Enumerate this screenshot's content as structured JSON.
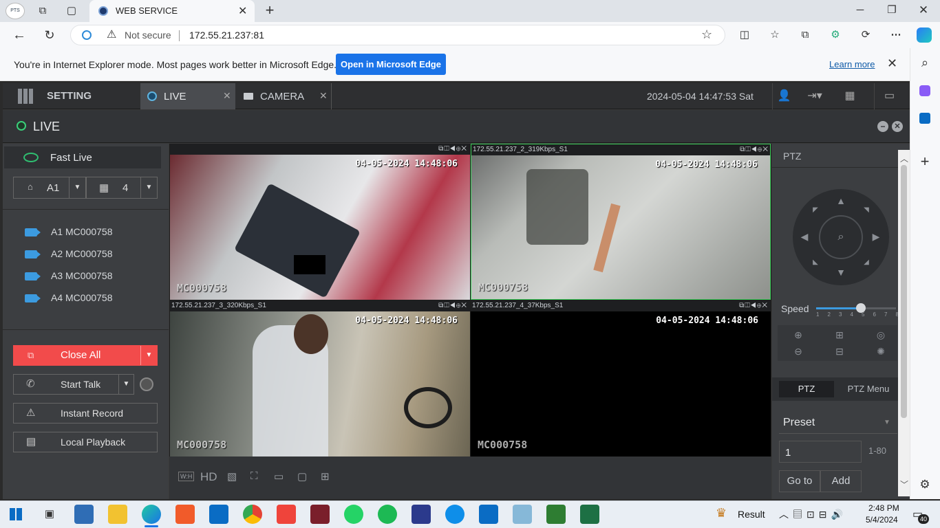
{
  "browser": {
    "tab_title": "WEB SERVICE",
    "security_label": "Not secure",
    "url": "172.55.21.237:81",
    "ie_message": "You're in Internet Explorer mode. Most pages work better in Microsoft Edge.",
    "open_in_edge": "Open in Microsoft Edge",
    "learn_more": "Learn more"
  },
  "app": {
    "tabs": [
      {
        "label": "SETTING"
      },
      {
        "label": "LIVE"
      },
      {
        "label": "CAMERA"
      }
    ],
    "datetime": "2024-05-04 14:47:53 Sat",
    "live_title": "LIVE",
    "left": {
      "fast_live": "Fast Live",
      "group_select": "A1",
      "split_select": "4",
      "channels": [
        "A1 MC000758",
        "A2 MC000758",
        "A3 MC000758",
        "A4 MC000758"
      ],
      "close_all": "Close All",
      "start_talk": "Start Talk",
      "instant_record": "Instant Record",
      "local_playback": "Local Playback"
    },
    "videos": [
      {
        "title": "",
        "stamp": "04-05-2024 14:48:06",
        "name": "MC000758"
      },
      {
        "title": "172.55.21.237_2_319Kbps_S1",
        "stamp": "04-05-2024 14:48:06",
        "name": "MC000758"
      },
      {
        "title": "172.55.21.237_3_320Kbps_S1",
        "stamp": "04-05-2024 14:48:06",
        "name": "MC000758"
      },
      {
        "title": "172.55.21.237_4_37Kbps_S1",
        "stamp": "04-05-2024 14:48:06",
        "name": "MC000758"
      }
    ],
    "bottom_toolbar": {
      "ratio": "W:H",
      "hd": "HD"
    },
    "ptz": {
      "title": "PTZ",
      "speed_label": "Speed",
      "speed_ticks": [
        "1",
        "2",
        "3",
        "4",
        "5",
        "6",
        "7",
        "8"
      ],
      "speed_value": 5,
      "tab_ptz": "PTZ",
      "tab_menu": "PTZ Menu",
      "preset_label": "Preset",
      "preset_value": "1",
      "preset_range": "1-80",
      "goto": "Go to",
      "add": "Add"
    }
  },
  "taskbar": {
    "result_label": "Result",
    "time": "2:48 PM",
    "date": "5/4/2024",
    "notifications": "40"
  },
  "colors": {
    "accent_red": "#f24b4b",
    "edge_blue": "#1a73e8",
    "cam_blue": "#3c9be0",
    "green_icon": "#2fbf71"
  }
}
